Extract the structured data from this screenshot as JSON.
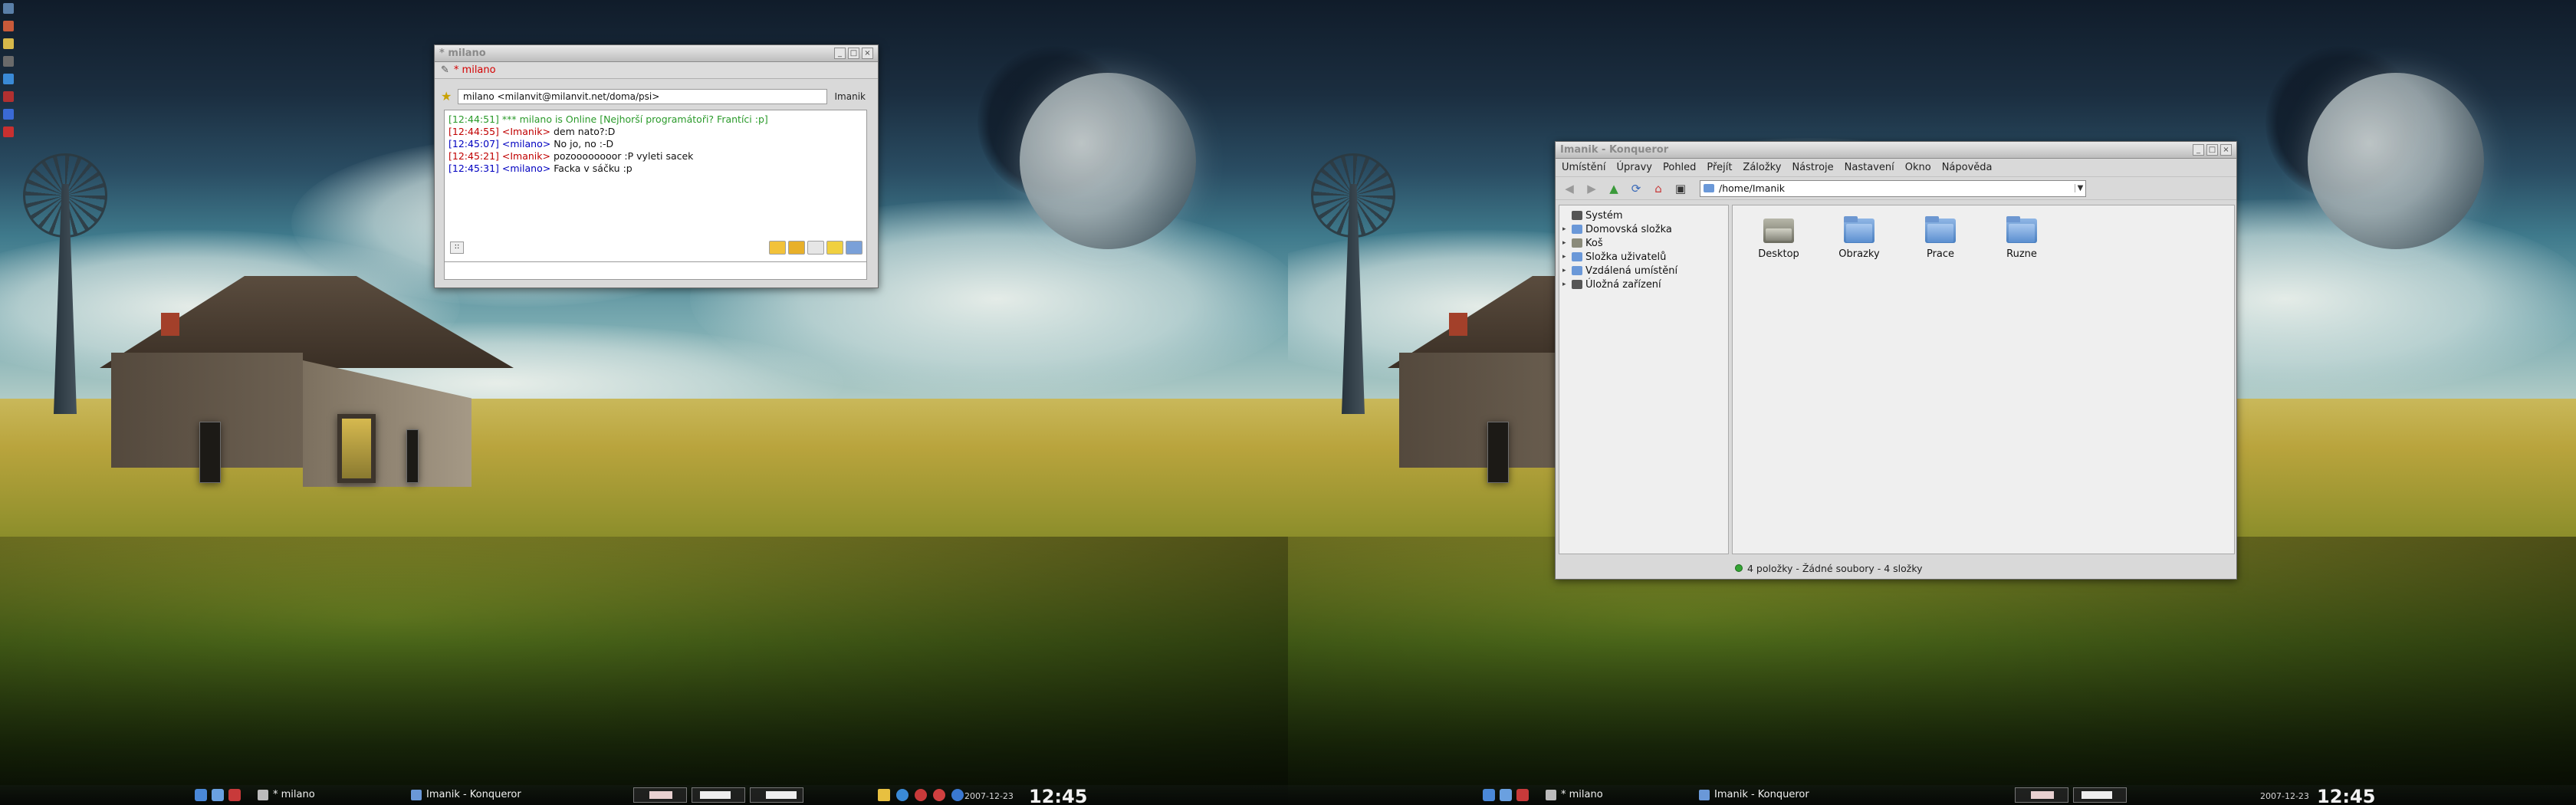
{
  "chat_window": {
    "title": "* milano",
    "tab_label": "* milano",
    "contact_address": "milano <milanvit@milanvit.net/doma/psi>",
    "own_nick": "Imanik",
    "messages": [
      {
        "time": "[12:44:51]",
        "sender": "",
        "text": "*** milano is Online [Nejhorší programátoři? Frantíci :p]",
        "color": "#2a9a2a"
      },
      {
        "time": "[12:44:55]",
        "sender": "<Imanik>",
        "text": "dem nato?:D",
        "color": "#c00000"
      },
      {
        "time": "[12:45:07]",
        "sender": "<milano>",
        "text": "No jo, no :-D",
        "color": "#0000c0"
      },
      {
        "time": "[12:45:21]",
        "sender": "<Imanik>",
        "text": "pozoooooooor :P vyleti sacek",
        "color": "#c00000"
      },
      {
        "time": "[12:45:31]",
        "sender": "<milano>",
        "text": "Facka v sáčku :p",
        "color": "#0000c0"
      }
    ]
  },
  "konqueror": {
    "title": "Imanik - Konqueror",
    "menu": [
      "Umístění",
      "Úpravy",
      "Pohled",
      "Přejít",
      "Záložky",
      "Nástroje",
      "Nastavení",
      "Okno",
      "Nápověda"
    ],
    "location": "/home/Imanik",
    "tree": [
      {
        "label": "Systém",
        "expander": ""
      },
      {
        "label": "Domovská složka",
        "expander": "▸"
      },
      {
        "label": "Koš",
        "expander": "▸"
      },
      {
        "label": "Složka uživatelů",
        "expander": "▸"
      },
      {
        "label": "Vzdálená umístění",
        "expander": "▸"
      },
      {
        "label": "Úložná zařízení",
        "expander": "▸"
      }
    ],
    "folders": [
      "Desktop",
      "Obrazky",
      "Prace",
      "Ruzne"
    ],
    "status": "4 položky - Žádné soubory - 4 složky"
  },
  "taskbar": {
    "task_chat": "* milano",
    "task_konqueror": "Imanik - Konqueror",
    "date": "2007-12-23",
    "clock": "12:45"
  },
  "colors": {
    "nick_self": "#c00000",
    "nick_other": "#0000c0",
    "status_online": "#2a9a2a"
  }
}
